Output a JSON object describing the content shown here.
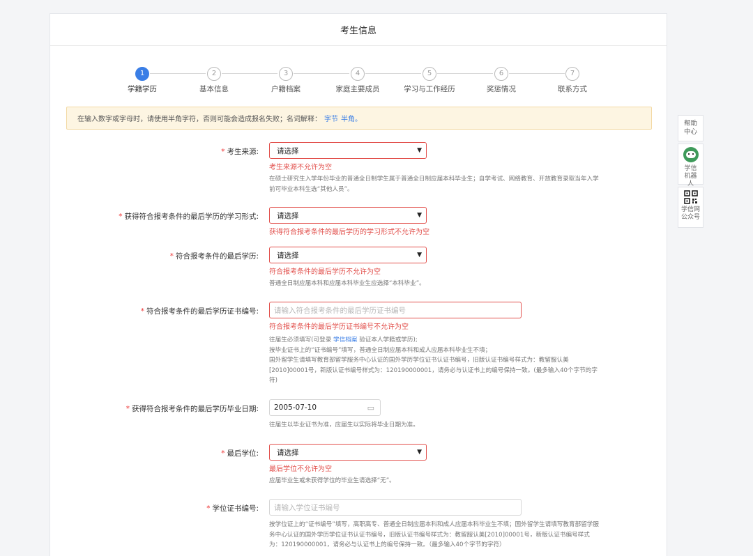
{
  "header": {
    "title": "考生信息"
  },
  "steps": [
    {
      "num": "1",
      "label": "学籍学历"
    },
    {
      "num": "2",
      "label": "基本信息"
    },
    {
      "num": "3",
      "label": "户籍档案"
    },
    {
      "num": "4",
      "label": "家庭主要成员"
    },
    {
      "num": "5",
      "label": "学习与工作经历"
    },
    {
      "num": "6",
      "label": "奖惩情况"
    },
    {
      "num": "7",
      "label": "联系方式"
    }
  ],
  "notice": {
    "text": "在输入数字或字母时，请使用半角字符，否则可能会造成报名失败；名词解释：",
    "link1": "字节",
    "link2": "半角。"
  },
  "form": {
    "source": {
      "label": "考生来源:",
      "value": "请选择",
      "error": "考生来源不允许为空",
      "hint": "在硕士研究生入学年份毕业的普通全日制学生属于普通全日制应届本科毕业生；自学考试、网络教育、开放教育录取当年入学前可毕业本科生选“其他人员”。"
    },
    "study_form": {
      "label": "获得符合报考条件的最后学历的学习形式:",
      "value": "请选择",
      "error": "获得符合报考条件的最后学历的学习形式不允许为空"
    },
    "last_edu": {
      "label": "符合报考条件的最后学历:",
      "value": "请选择",
      "error": "符合报考条件的最后学历不允许为空",
      "hint": "普通全日制应届本科和应届本科毕业生应选择“本科毕业”。"
    },
    "cert_no": {
      "label": "符合报考条件的最后学历证书编号:",
      "placeholder": "请输入符合报考条件的最后学历证书编号",
      "error": "符合报考条件的最后学历证书编号不允许为空",
      "hint_pre": "往届生必须填写(可登录 ",
      "hint_link": "学信档案",
      "hint_post": " 验证本人学籍或学历);",
      "hint_line2": "按毕业证书上的“证书编号”填写，普通全日制应届本科和成人应届本科毕业生不填；",
      "hint_line3": "国外留学生请填写教育部留学服务中心认证的国外学历学位证书认证书编号，旧版认证书编号样式为：教留服认美[2010]00001号，新版认证书编号样式为：120190000001，请务必与认证书上的编号保持一致。(最多输入40个字节的字符)"
    },
    "grad_date": {
      "label": "获得符合报考条件的最后学历毕业日期:",
      "value": "2005-07-10",
      "hint": "往届生以毕业证书为准，应届生以实际将毕业日期为准。"
    },
    "degree": {
      "label": "最后学位:",
      "value": "请选择",
      "error": "最后学位不允许为空",
      "hint": "应届毕业生或未获得学位的毕业生请选择“无”。"
    },
    "degree_cert": {
      "label": "学位证书编号:",
      "placeholder": "请输入学位证书编号",
      "hint": "按学位证上的“证书编号”填写，高职高专、普通全日制应届本科和成人应届本科毕业生不填；国外留学生请填写教育部留学服务中心认证的国外学历学位证书认证书编号，旧版认证书编号样式为：教留服认美[2010]00001号，新版认证书编号样式为：120190000001，请务必与认证书上的编号保持一致。（最多输入40个字节的字符）"
    }
  },
  "side": {
    "help": "帮助中心",
    "robot": "学信机器人",
    "qr": "学信网公众号"
  }
}
